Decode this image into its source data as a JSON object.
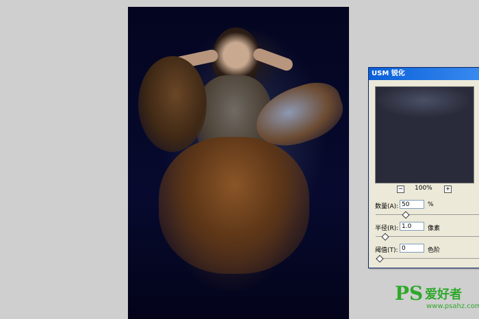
{
  "dialog": {
    "title": "USM 锐化",
    "zoom_out": "−",
    "zoom_in": "+",
    "zoom": "100%",
    "amount": {
      "label": "数量(A):",
      "value": "50",
      "unit": "%",
      "level": 0.25
    },
    "radius": {
      "label": "半径(R):",
      "value": "1.0",
      "unit": "像素",
      "level": 0.05
    },
    "threshold": {
      "label": "阈值(T):",
      "value": "0",
      "unit": "色阶",
      "level": 0.0
    }
  },
  "watermark": {
    "logo": "PS",
    "brand": "爱好者",
    "url": "www.psahz.com"
  },
  "colors": {
    "accent": "#2fa82c",
    "titlebar": "#0a5fd8"
  }
}
